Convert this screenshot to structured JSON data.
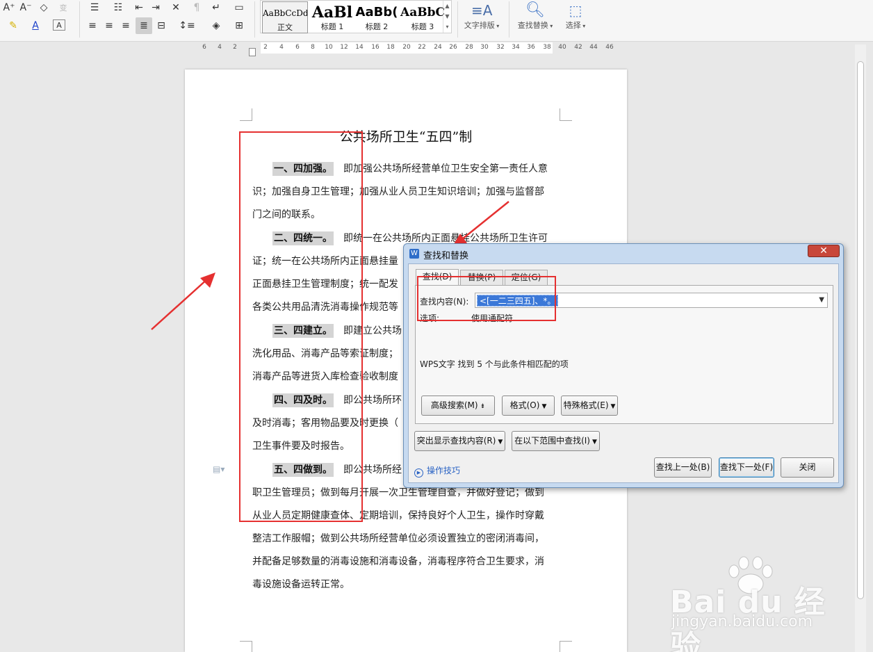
{
  "ribbon": {
    "styles": [
      {
        "preview": "AaBbCcDd",
        "name": "正文"
      },
      {
        "preview": "AaBl",
        "name": "标题 1"
      },
      {
        "preview": "AaBb(",
        "name": "标题 2"
      },
      {
        "preview": "AaBbC",
        "name": "标题 3"
      }
    ],
    "text_layout_label": "文字排版",
    "find_replace_label": "查找替换",
    "select_label": "选择"
  },
  "ruler": {
    "ticks": [
      "6",
      "4",
      "2",
      "2",
      "4",
      "6",
      "8",
      "10",
      "12",
      "14",
      "16",
      "18",
      "20",
      "22",
      "24",
      "26",
      "28",
      "30",
      "32",
      "34",
      "36",
      "38",
      "40",
      "42",
      "44",
      "46"
    ]
  },
  "document": {
    "title": "公共场所卫生“五四”制",
    "paragraphs": [
      {
        "heading": "一、四加强。",
        "lines": [
          "即加强公共场所经营单位卫生安全第一责任人意",
          "识；加强自身卫生管理；加强从业人员卫生知识培训；加强与监督部",
          "门之间的联系。"
        ]
      },
      {
        "heading": "二、四统一。",
        "lines": [
          "即统一在公共场所内正面悬挂公共场所卫生许可",
          "证；统一在公共场所内正面悬挂量",
          "正面悬挂卫生管理制度；统一配发",
          "各类公共用品清洗消毒操作规范等"
        ]
      },
      {
        "heading": "三、四建立。",
        "lines": [
          "即建立公共场",
          "洗化用品、消毒产品等索证制度；",
          "消毒产品等进货入库检查验收制度"
        ]
      },
      {
        "heading": "四、四及时。",
        "lines": [
          "即公共场所环",
          "及时消毒；客用物品要及时更换（",
          "卫生事件要及时报告。"
        ]
      },
      {
        "heading": "五、四做到。",
        "lines": [
          "即公共场所经",
          "职卫生管理员；做到每月开展一次卫生管理自查，并做好登记；做到",
          "从业人员定期健康查体、定期培训，保持良好个人卫生，操作时穿戴",
          "整洁工作服帽；做到公共场所经营单位必须设置独立的密闭消毒间，",
          "并配备足够数量的消毒设施和消毒设备，消毒程序符合卫生要求，消",
          "毒设施设备运转正常。"
        ]
      }
    ]
  },
  "dialog": {
    "title": "查找和替换",
    "close_glyph": "✕",
    "tabs": [
      "查找(D)",
      "替换(P)",
      "定位(G)"
    ],
    "find_label": "查找内容(N):",
    "find_value": "<[一二三四五]、*。",
    "options_label": "选项:",
    "options_value": "使用通配符",
    "result_text": "WPS文字 找到 5 个与此条件相匹配的项",
    "buttons": {
      "advanced": "高级搜索(M)",
      "format": "格式(O)",
      "special": "特殊格式(E)",
      "highlight": "突出显示查找内容(R)",
      "scope": "在以下范围中查找(I)",
      "tips": "操作技巧",
      "prev": "查找上一处(B)",
      "next": "查找下一处(F)",
      "close": "关闭"
    }
  },
  "watermark": {
    "brand": "Bai du 经验",
    "url": "jingyan.baidu.com"
  },
  "colors": {
    "annotation": "#e53030",
    "selection": "#3b78d8"
  }
}
